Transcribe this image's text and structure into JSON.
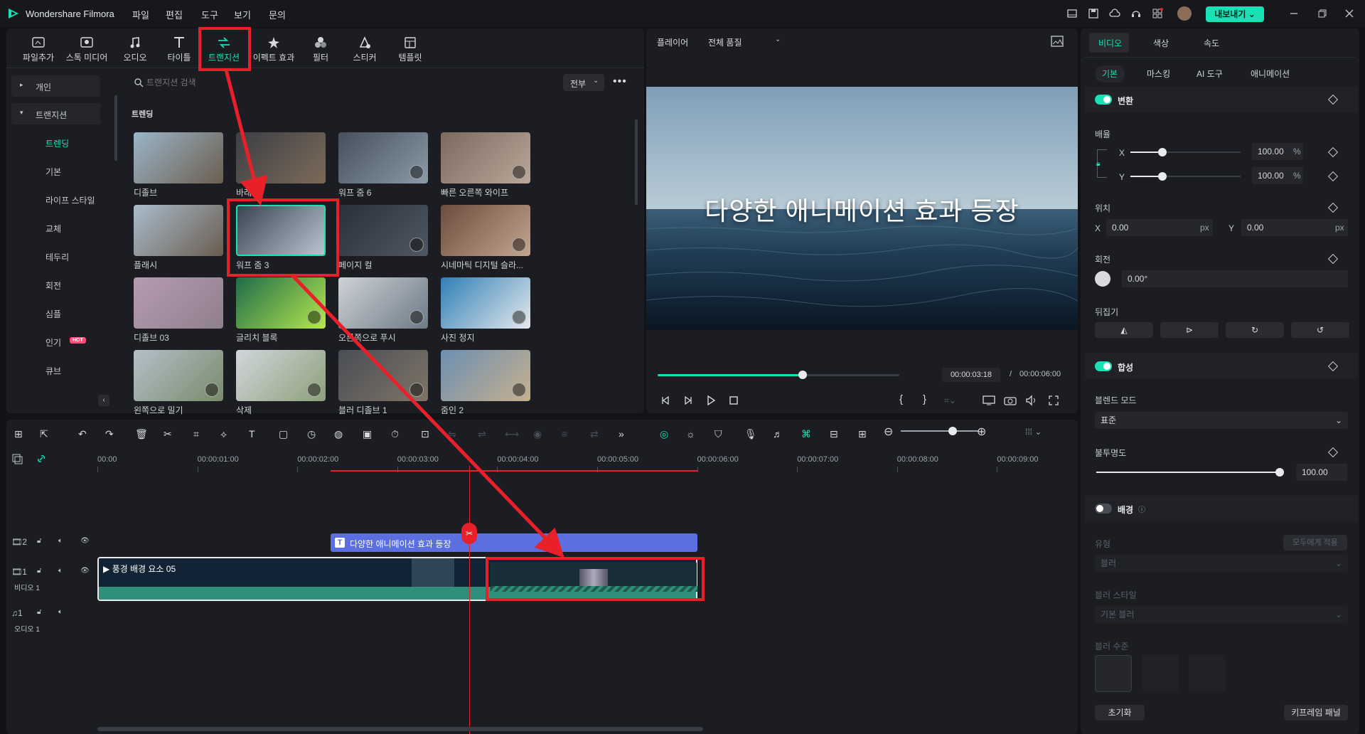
{
  "app": {
    "title": "Wondershare Filmora"
  },
  "menu": [
    "파일",
    "편집",
    "도구",
    "보기",
    "문의"
  ],
  "export_label": "내보내기",
  "media_toolbar": [
    {
      "label": "파일추가",
      "icon": "import-icon"
    },
    {
      "label": "스톡 미디어",
      "icon": "stock-media-icon"
    },
    {
      "label": "오디오",
      "icon": "audio-note-icon"
    },
    {
      "label": "타이틀",
      "icon": "title-t-icon"
    },
    {
      "label": "트랜지션",
      "icon": "transition-icon"
    },
    {
      "label": "이펙트 효과",
      "icon": "effects-icon"
    },
    {
      "label": "필터",
      "icon": "filter-icon"
    },
    {
      "label": "스티커",
      "icon": "sticker-icon"
    },
    {
      "label": "템플릿",
      "icon": "template-icon"
    }
  ],
  "sidebar": {
    "personal": "개인",
    "transitions": "트랜지션",
    "items": [
      "트렌딩",
      "기본",
      "라이프 스타일",
      "교체",
      "테두리",
      "회전",
      "심플",
      "인기",
      "큐브"
    ],
    "hot_badge": "HOT"
  },
  "search": {
    "placeholder": "트랜지션 검색",
    "filter": "전부"
  },
  "section_title": "트렌딩",
  "thumbnails": [
    "디졸브",
    "바래다",
    "워프 줌 6",
    "빠른 오른쪽 와이프",
    "플래시",
    "워프 줌 3",
    "페이지 컬",
    "시네마틱 디지털 슬라...",
    "디졸브 03",
    "글리치 블록",
    "오른쪽으로 푸시",
    "사진 정지",
    "왼쪽으로 밀기",
    "삭제",
    "블러 디졸브 1",
    "줌인 2"
  ],
  "player": {
    "label": "플레이어",
    "quality": "전체 품질",
    "caption": "다양한 애니메이션 효과 등장",
    "current_time": "00:00:03:18",
    "separator": "/",
    "total_time": "00:00:06:00",
    "progress": 0.6
  },
  "properties": {
    "tabs": [
      "비디오",
      "색상",
      "속도"
    ],
    "sub_tabs": [
      "기본",
      "마스킹",
      "AI 도구",
      "애니메이션"
    ],
    "transform": "변환",
    "scale": "배율",
    "x": "X",
    "y": "Y",
    "scale_x": "100.00",
    "scale_y": "100.00",
    "percent": "%",
    "position": "위치",
    "pos_x": "0.00",
    "pos_y": "0.00",
    "px": "px",
    "rotation": "회전",
    "rotation_value": "0.00°",
    "flip": "뒤집기",
    "composite": "합성",
    "blend_mode": "블렌드 모드",
    "blend_value": "표준",
    "opacity": "불투명도",
    "opacity_value": "100.00",
    "background": "배경",
    "type": "유형",
    "apply_all": "모두에게 적용",
    "type_value": "블러",
    "blur_style": "블러 스타일",
    "blur_style_value": "기본 블러",
    "blur_level": "블러 수준",
    "reset": "초기화",
    "keyframe_panel": "키프레임 패널"
  },
  "timeline": {
    "ruler": [
      "00:00",
      "00:00:01:00",
      "00:00:02:00",
      "00:00:03:00",
      "00:00:04:00",
      "00:00:05:00",
      "00:00:06:00",
      "00:00:07:00",
      "00:00:08:00",
      "00:00:09:00"
    ],
    "title_clip": "다양한 애니메이션 효과 등장",
    "video_clip": "풍경 배경 요소 05",
    "track2_num": "2",
    "track1_num": "1",
    "video_label": "비디오 1",
    "audio_num": "1",
    "audio_label": "오디오 1"
  },
  "colors": {
    "accent": "#19e0b5",
    "annotation": "#e8202a",
    "title_clip": "#5b6fe0",
    "video_clip": "#2f8f7a"
  }
}
